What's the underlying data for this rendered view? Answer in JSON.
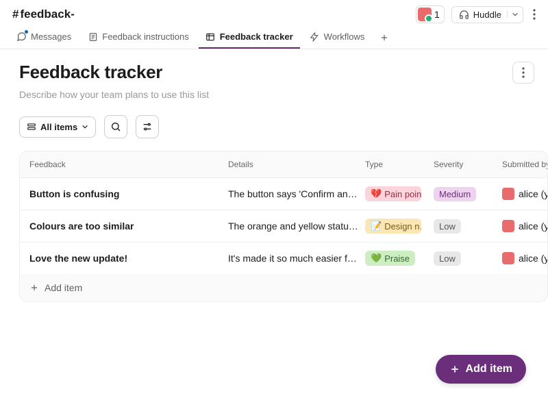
{
  "header": {
    "channel_prefix": "#",
    "channel_name": "feedback-",
    "member_count": "1",
    "huddle_label": "Huddle"
  },
  "tabs": {
    "messages": "Messages",
    "instructions": "Feedback instructions",
    "tracker": "Feedback tracker",
    "workflows": "Workflows"
  },
  "page": {
    "title": "Feedback tracker",
    "subtitle": "Describe how your team plans to use this list"
  },
  "toolbar": {
    "all_items": "All items"
  },
  "columns": {
    "feedback": "Feedback",
    "details": "Details",
    "type": "Type",
    "severity": "Severity",
    "submitted_by": "Submitted by"
  },
  "rows": [
    {
      "feedback": "Button is confusing",
      "details": "The button says 'Confirm and …",
      "type_emoji": "💔",
      "type_label": "Pain point",
      "type_class": "tag-pain",
      "severity": "Medium",
      "severity_class": "sev-med",
      "user": "alice (you"
    },
    {
      "feedback": "Colours are too similar",
      "details": "The orange and yellow status …",
      "type_emoji": "📝",
      "type_label": "Design n…",
      "type_class": "tag-design",
      "severity": "Low",
      "severity_class": "sev-low",
      "user": "alice (you"
    },
    {
      "feedback": "Love the new update!",
      "details": "It's made it so much easier for m…",
      "type_emoji": "💚",
      "type_label": "Praise",
      "type_class": "tag-praise",
      "severity": "Low",
      "severity_class": "sev-low",
      "user": "alice (you"
    }
  ],
  "add_item_row": "Add item",
  "fab": "Add item"
}
